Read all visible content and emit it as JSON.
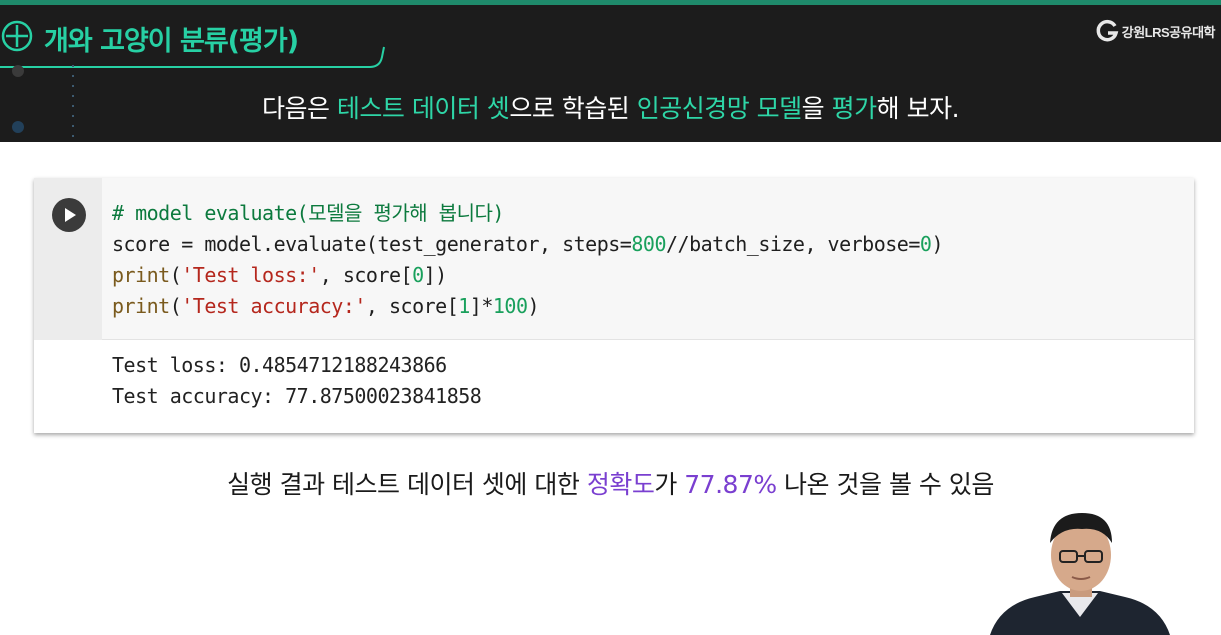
{
  "header": {
    "title": "개와 고양이 분류(평가)",
    "brand": "강원LRS공유대학",
    "subtitle": {
      "part1": "다음은 ",
      "hl1": "테스트 데이터 셋",
      "part2": "으로 학습된 ",
      "hl2": "인공신경망 모델",
      "part3": "을 ",
      "hl3": "평가",
      "part4": "해 보자."
    },
    "accent_color": "#27d0a4"
  },
  "notebook": {
    "code_lines": {
      "l1_comment": "# model evaluate(모델을 평가해 봅니다)",
      "l2_a": "score = model.evaluate(test_generator, steps=",
      "l2_num": "800",
      "l2_b": "//batch_size, verbose=",
      "l2_num2": "0",
      "l2_c": ")",
      "l3_fn": "print",
      "l3_a": "(",
      "l3_str": "'Test loss:'",
      "l3_b": ", score[",
      "l3_num": "0",
      "l3_c": "])",
      "l4_fn": "print",
      "l4_a": "(",
      "l4_str": "'Test accuracy:'",
      "l4_b": ", score[",
      "l4_num": "1",
      "l4_c": "]*",
      "l4_num2": "100",
      "l4_d": ")"
    },
    "output_lines": [
      "Test loss: 0.4854712188243866",
      "Test accuracy: 77.87500023841858"
    ]
  },
  "caption": {
    "part1": "실행 결과 테스트 데이터 셋에 대한 ",
    "hl1": "정확도",
    "part2": "가 ",
    "hl2": "77.87%",
    "part3": " 나온 것을 볼 수 있음"
  }
}
